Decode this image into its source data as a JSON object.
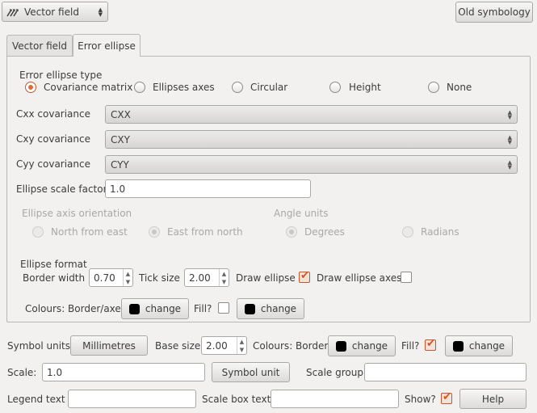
{
  "header": {
    "renderer_select": "Vector field",
    "old_symbology_button": "Old symbology"
  },
  "tabs": [
    {
      "label": "Vector field",
      "active": false
    },
    {
      "label": "Error ellipse",
      "active": true
    }
  ],
  "error_ellipse": {
    "type_heading": "Error ellipse type",
    "type_options": [
      {
        "label": "Covariance matrix",
        "selected": true
      },
      {
        "label": "Ellipses axes",
        "selected": false
      },
      {
        "label": "Circular",
        "selected": false
      },
      {
        "label": "Height",
        "selected": false
      },
      {
        "label": "None",
        "selected": false
      }
    ],
    "fields": [
      {
        "label": "Cxx covariance",
        "value": "CXX"
      },
      {
        "label": "Cxy covariance",
        "value": "CXY"
      },
      {
        "label": "Cyy covariance",
        "value": "CYY"
      }
    ],
    "scale_factor_label": "Ellipse scale factor",
    "scale_factor_value": "1.0",
    "orientation_heading": "Ellipse axis orientation",
    "orientation_options": [
      {
        "label": "North from east",
        "selected": false
      },
      {
        "label": "East from north",
        "selected": true
      }
    ],
    "angle_heading": "Angle units",
    "angle_options": [
      {
        "label": "Degrees",
        "selected": true
      },
      {
        "label": "Radians",
        "selected": false
      }
    ],
    "format_heading": "Ellipse format",
    "border_width_label": "Border width",
    "border_width_value": "0.70",
    "tick_size_label": "Tick size",
    "tick_size_value": "2.00",
    "draw_ellipse_label": "Draw ellipse",
    "draw_ellipse_checked": true,
    "draw_axes_label": "Draw ellipse axes",
    "draw_axes_checked": false,
    "colours_label": "Colours: Border/axes",
    "change_label": "change",
    "fill_label": "Fill?",
    "fill_checked": false
  },
  "bottom": {
    "symbol_units_label": "Symbol units",
    "symbol_units_button": "Millimetres",
    "base_size_label": "Base size",
    "base_size_value": "2.00",
    "colours_border_label": "Colours: Border",
    "change_label": "change",
    "fill_label": "Fill?",
    "fill_checked": true,
    "scale_label": "Scale:",
    "scale_value": "1.0",
    "symbol_unit_button": "Symbol unit",
    "scale_group_label": "Scale group",
    "scale_group_value": "",
    "legend_text_label": "Legend text",
    "legend_text_value": "",
    "scale_box_text_label": "Scale box text",
    "scale_box_text_value": "",
    "show_label": "Show?",
    "show_checked": true,
    "help_button": "Help"
  },
  "colors": {
    "accent": "#e06a3a",
    "swatch": "#000000"
  }
}
